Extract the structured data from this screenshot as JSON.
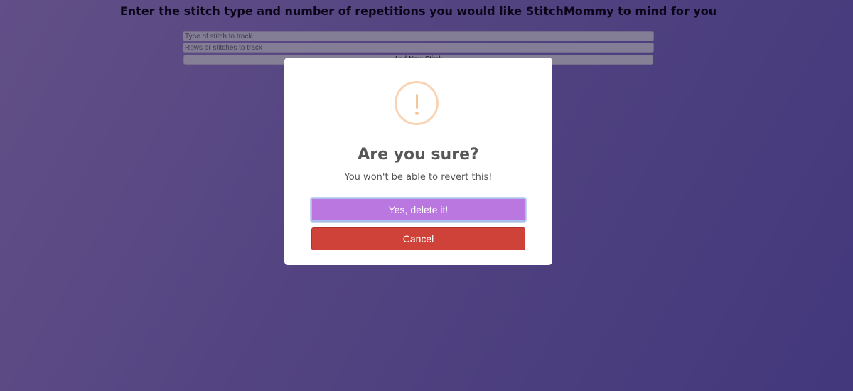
{
  "page": {
    "title": "Enter the stitch type and number of repetitions you would like StitchMommy to mind for you",
    "stitch_type_placeholder": "Type of stitch to track",
    "stitch_count_placeholder": "Rows or stitches to track",
    "add_button_label": "Add New Stitch"
  },
  "dialog": {
    "icon": "warning-exclamation-icon",
    "title": "Are you sure?",
    "text": "You won't be able to revert this!",
    "confirm_label": "Yes, delete it!",
    "cancel_label": "Cancel"
  },
  "colors": {
    "background_gradient_start": "#a98ed6",
    "background_gradient_end": "#6e62c0",
    "warning": "#f8bb86",
    "confirm_button": "#bb77e0",
    "cancel_button": "#cf4239"
  }
}
